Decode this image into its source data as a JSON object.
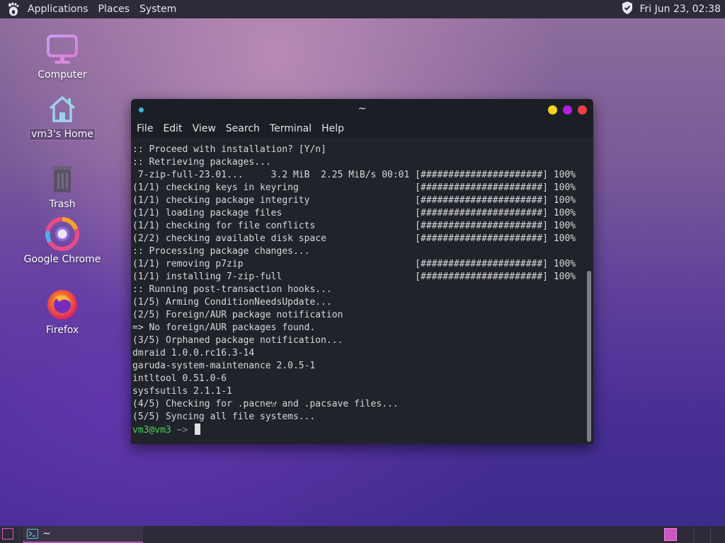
{
  "top_panel": {
    "menus": [
      "Applications",
      "Places",
      "System"
    ],
    "clock": "Fri Jun 23, 02:38"
  },
  "desktop": {
    "icons": [
      {
        "label": "Computer",
        "icon": "computer-icon"
      },
      {
        "label": "vm3's Home",
        "icon": "home-icon"
      },
      {
        "label": "Trash",
        "icon": "trash-icon"
      },
      {
        "label": "Google Chrome",
        "icon": "chrome-icon"
      },
      {
        "label": "Firefox",
        "icon": "firefox-icon"
      }
    ]
  },
  "terminal": {
    "title": "~",
    "menu": [
      "File",
      "Edit",
      "View",
      "Search",
      "Terminal",
      "Help"
    ],
    "lines": [
      ":: Proceed with installation? [Y/n]",
      ":: Retrieving packages...",
      " 7-zip-full-23.01...     3.2 MiB  2.25 MiB/s 00:01 [######################] 100%",
      "(1/1) checking keys in keyring                     [######################] 100%",
      "(1/1) checking package integrity                   [######################] 100%",
      "(1/1) loading package files                        [######################] 100%",
      "(1/1) checking for file conflicts                  [######################] 100%",
      "(2/2) checking available disk space                [######################] 100%",
      ":: Processing package changes...",
      "(1/1) removing p7zip                               [######################] 100%",
      "(1/1) installing 7-zip-full                        [######################] 100%",
      ":: Running post-transaction hooks...",
      "(1/5) Arming ConditionNeedsUpdate...",
      "(2/5) Foreign/AUR package notification",
      "=> No foreign/AUR packages found.",
      "(3/5) Orphaned package notification...",
      "dmraid 1.0.0.rc16.3-14",
      "garuda-system-maintenance 2.0.5-1",
      "intltool 0.51.0-6",
      "sysfsutils 2.1.1-1",
      "(4/5) Checking for .pacnew and .pacsave files...",
      "(5/5) Syncing all file systems..."
    ],
    "prompt_user": "vm3@vm3",
    "prompt_arrow": " ~> "
  },
  "taskbar": {
    "window_label": "~"
  },
  "colors": {
    "panel": "#2e2a3a",
    "terminal_bg": "#21232b",
    "prompt_green": "#4fd15e",
    "accent_magenta": "#c04ac8"
  }
}
